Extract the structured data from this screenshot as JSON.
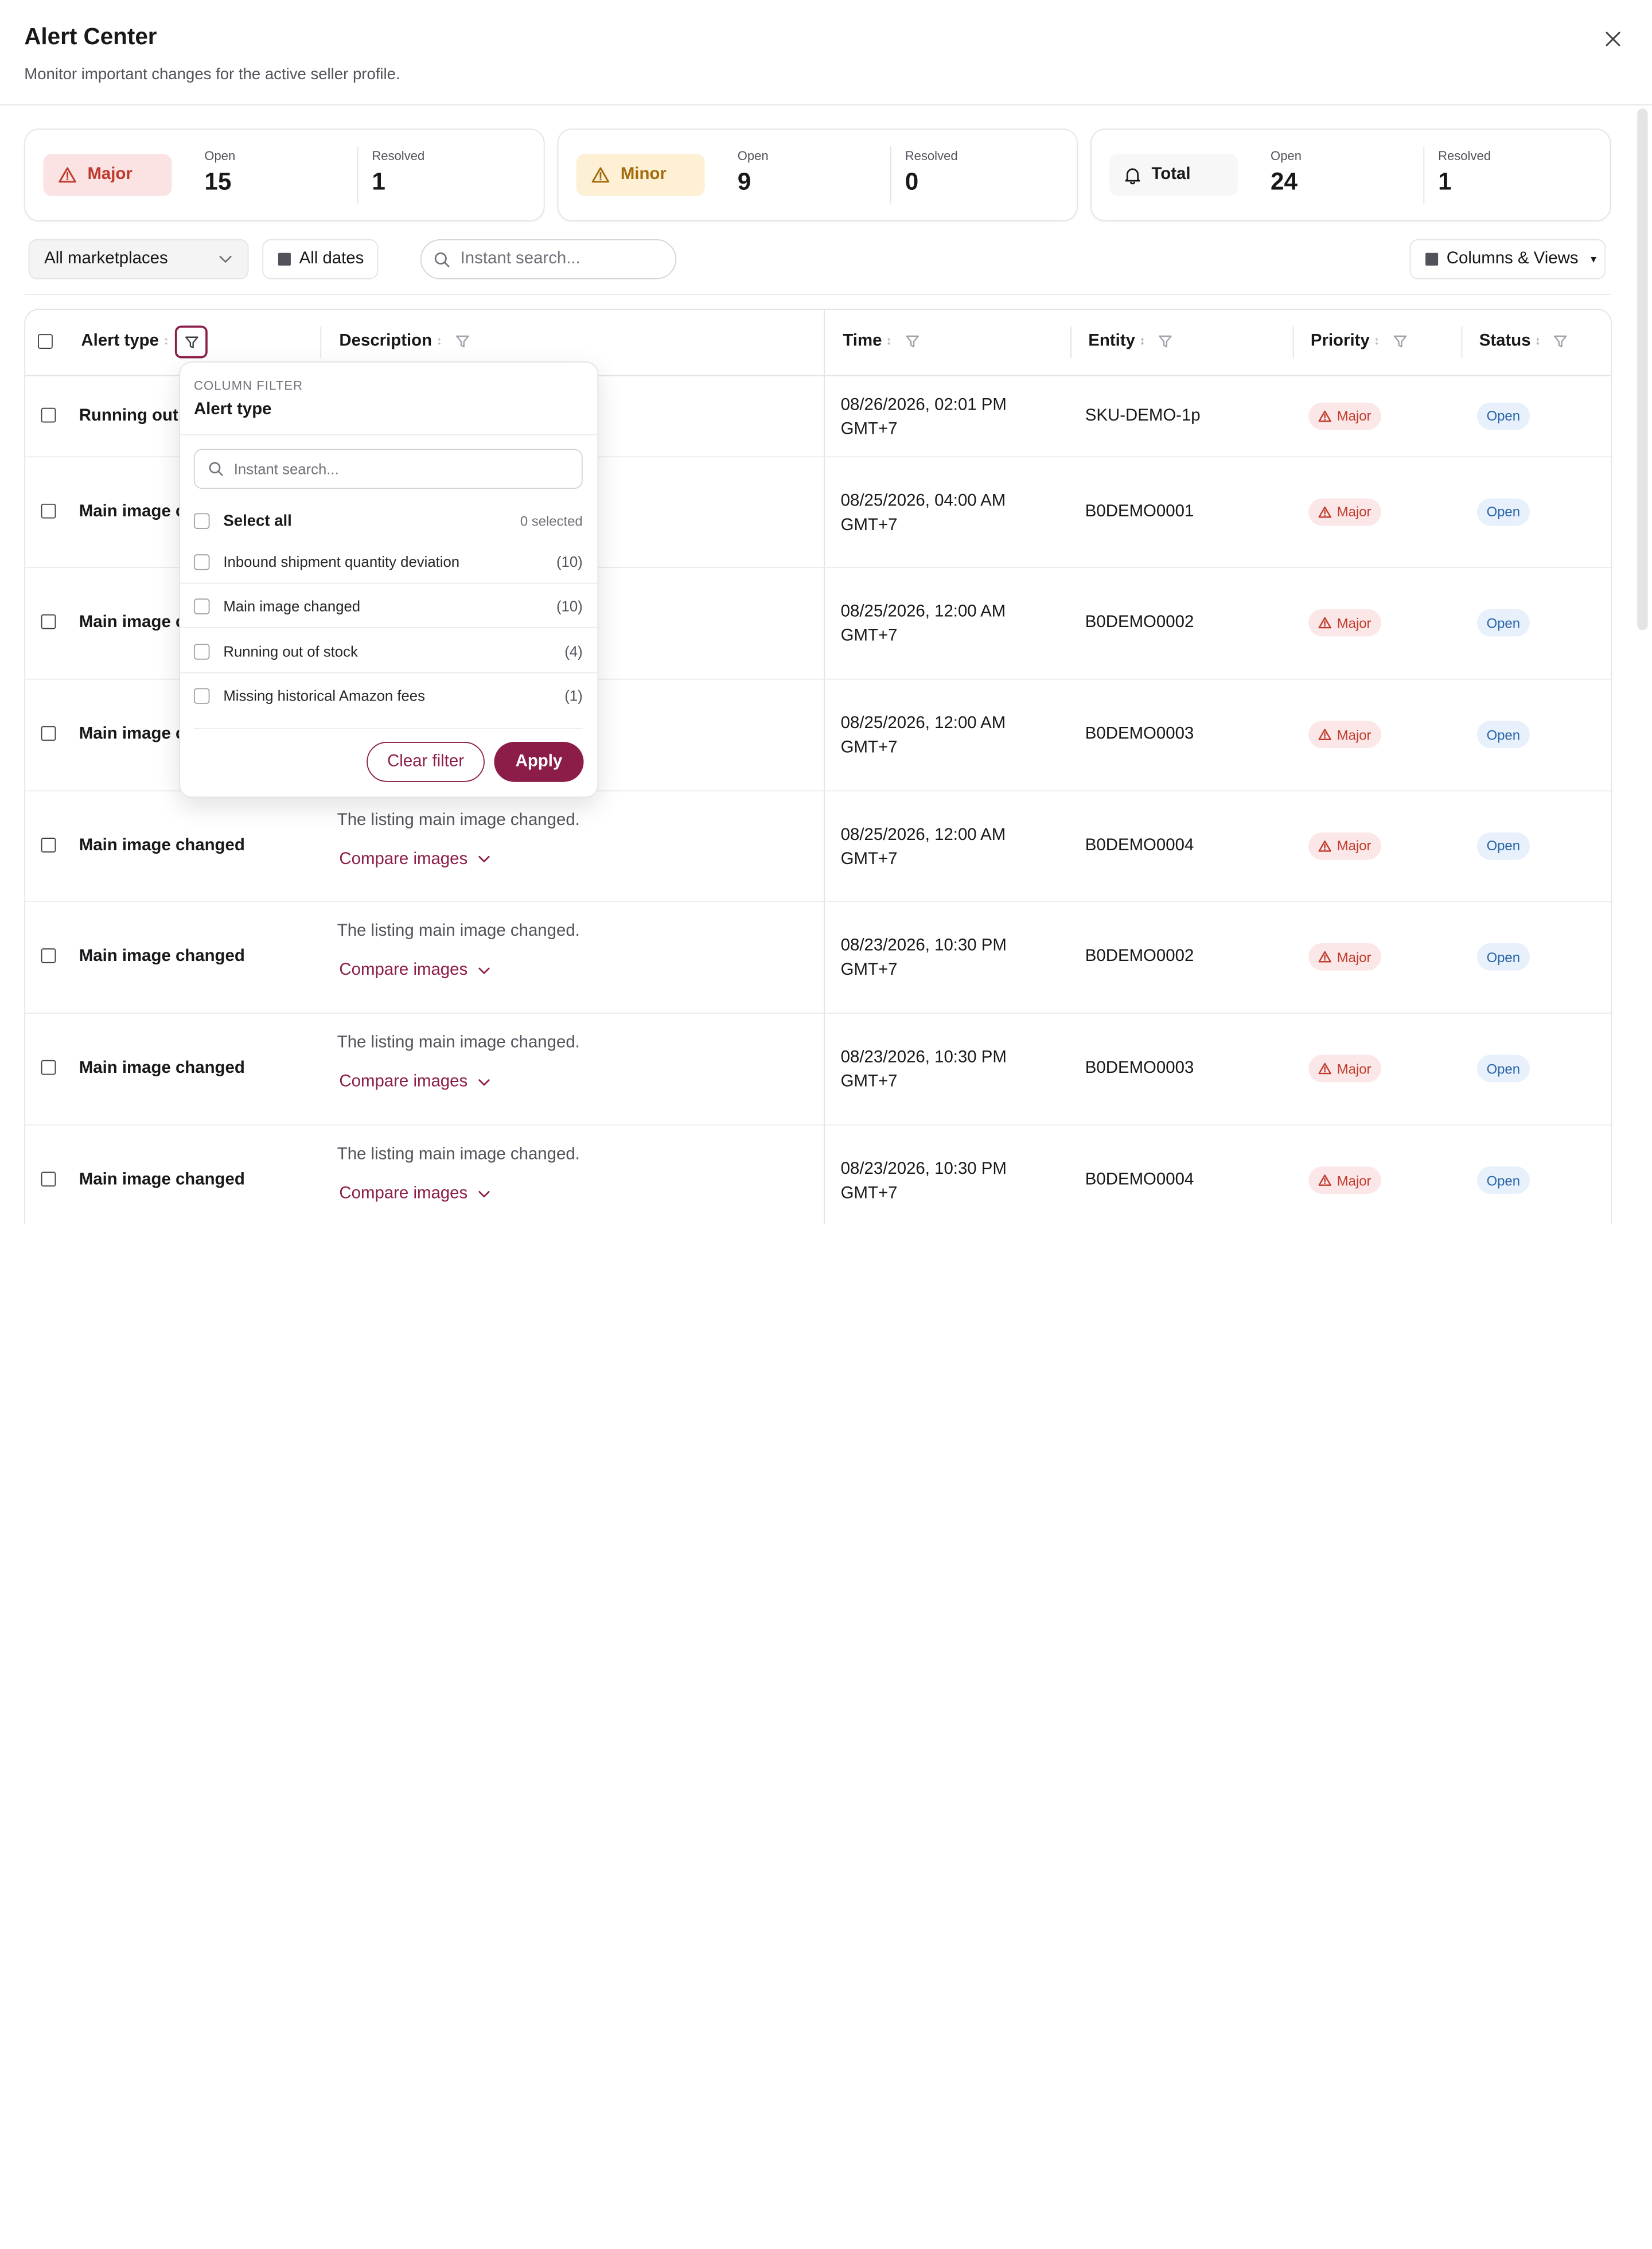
{
  "header": {
    "title": "Alert Center",
    "subtitle": "Monitor important changes for the active seller profile."
  },
  "stats": [
    {
      "label": "Major",
      "open_label": "Open",
      "open": "15",
      "resolved_label": "Resolved",
      "resolved": "1",
      "bg": "#fbe3e3",
      "fg": "#c0392b",
      "icon": "warning-icon"
    },
    {
      "label": "Minor",
      "open_label": "Open",
      "open": "9",
      "resolved_label": "Resolved",
      "resolved": "0",
      "bg": "#fdf0d5",
      "fg": "#a46a0b",
      "icon": "warning-icon"
    },
    {
      "label": "Total",
      "open_label": "Open",
      "open": "24",
      "resolved_label": "Resolved",
      "resolved": "1",
      "bg": "#f7f7f8",
      "fg": "#18181b",
      "icon": "bell-icon"
    }
  ],
  "toolbar": {
    "marketplace": "All marketplaces",
    "dates": "All dates",
    "search_placeholder": "Instant search...",
    "columns_views": "Columns & Views"
  },
  "columns": {
    "alert_type": "Alert type",
    "description": "Description",
    "time": "Time",
    "entity": "Entity",
    "priority": "Priority",
    "status": "Status"
  },
  "rows": [
    {
      "alert": "Running out o",
      "desc": "",
      "link": "",
      "time1": "08/26/2026, 02:01 PM",
      "time2": "GMT+7",
      "entity": "SKU-DEMO-1p",
      "priority": "Major",
      "status": "Open"
    },
    {
      "alert": "Main image c",
      "desc": "",
      "link": "",
      "time1": "08/25/2026, 04:00 AM",
      "time2": "GMT+7",
      "entity": "B0DEMO0001",
      "priority": "Major",
      "status": "Open"
    },
    {
      "alert": "Main image c",
      "desc": "",
      "link": "",
      "time1": "08/25/2026, 12:00 AM",
      "time2": "GMT+7",
      "entity": "B0DEMO0002",
      "priority": "Major",
      "status": "Open"
    },
    {
      "alert": "Main image c",
      "desc": "",
      "link": "",
      "time1": "08/25/2026, 12:00 AM",
      "time2": "GMT+7",
      "entity": "B0DEMO0003",
      "priority": "Major",
      "status": "Open"
    },
    {
      "alert": "Main image changed",
      "desc": "The listing main image changed.",
      "link": "Compare images",
      "time1": "08/25/2026, 12:00 AM",
      "time2": "GMT+7",
      "entity": "B0DEMO0004",
      "priority": "Major",
      "status": "Open"
    },
    {
      "alert": "Main image changed",
      "desc": "The listing main image changed.",
      "link": "Compare images",
      "time1": "08/23/2026, 10:30 PM",
      "time2": "GMT+7",
      "entity": "B0DEMO0002",
      "priority": "Major",
      "status": "Open"
    },
    {
      "alert": "Main image changed",
      "desc": "The listing main image changed.",
      "link": "Compare images",
      "time1": "08/23/2026, 10:30 PM",
      "time2": "GMT+7",
      "entity": "B0DEMO0003",
      "priority": "Major",
      "status": "Open"
    },
    {
      "alert": "Main image changed",
      "desc": "The listing main image changed.",
      "link": "Compare images",
      "time1": "08/23/2026, 10:30 PM",
      "time2": "GMT+7",
      "entity": "B0DEMO0004",
      "priority": "Major",
      "status": "Open"
    }
  ],
  "column_filter": {
    "label": "COLUMN FILTER",
    "title": "Alert type",
    "search_placeholder": "Instant search...",
    "select_all": "Select all",
    "selected_count": "0 selected",
    "options": [
      {
        "label": "Inbound shipment quantity deviation",
        "count": "(10)"
      },
      {
        "label": "Main image changed",
        "count": "(10)"
      },
      {
        "label": "Running out of stock",
        "count": "(4)"
      },
      {
        "label": "Missing historical Amazon fees",
        "count": "(1)"
      }
    ],
    "clear": "Clear filter",
    "apply": "Apply"
  },
  "colors": {
    "accent": "#8c1d48",
    "major_bg": "#fbe7e7",
    "major_fg": "#c0392b",
    "open_bg": "#e7f0fb",
    "open_fg": "#2563a8"
  }
}
